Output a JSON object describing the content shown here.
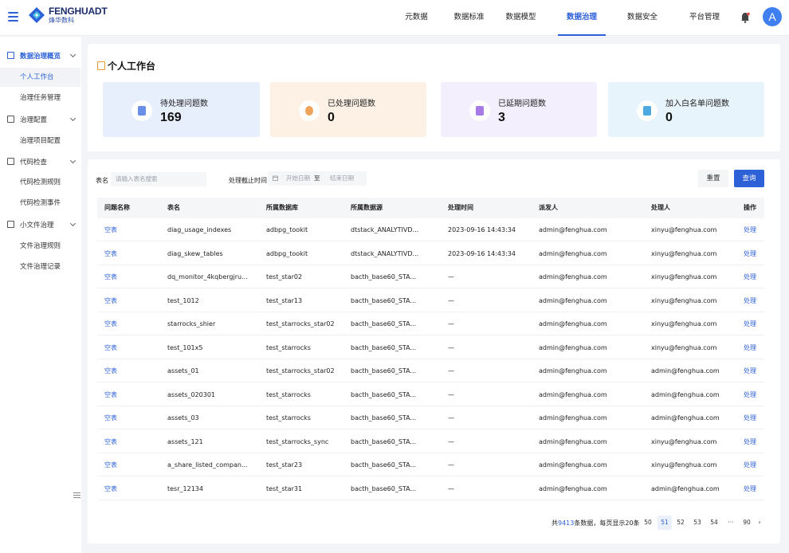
{
  "brand": {
    "name_en": "FENGHUADT",
    "name_cn": "烽华数科"
  },
  "nav": [
    "元数据",
    "数据标准",
    "数据模型",
    "数据治理",
    "数据安全",
    "平台管理"
  ],
  "nav_active": "数据治理",
  "user": {
    "avatar_letter": "A"
  },
  "sidebar": {
    "groups": [
      {
        "label": "数据治理概览",
        "items": [
          "个人工作台",
          "治理任务管理"
        ]
      },
      {
        "label": "治理配置",
        "items": [
          "治理项目配置"
        ]
      },
      {
        "label": "代码检查",
        "items": [
          "代码检测规则",
          "代码检测事件"
        ]
      },
      {
        "label": "小文件治理",
        "items": [
          "文件治理规则",
          "文件治理记录"
        ]
      }
    ],
    "active_item": "个人工作台"
  },
  "workbench": {
    "title": "个人工作台",
    "stats": [
      {
        "label": "待处理问题数",
        "value": "169",
        "bg": "#e7effd",
        "accent": "#6a8fe8"
      },
      {
        "label": "已处理问题数",
        "value": "0",
        "bg": "#fdf1e6",
        "accent": "#f0a35a"
      },
      {
        "label": "已延期问题数",
        "value": "3",
        "bg": "#f4effd",
        "accent": "#a77be6"
      },
      {
        "label": "加入白名单问题数",
        "value": "0",
        "bg": "#e8f4fb",
        "accent": "#4da9e0"
      }
    ]
  },
  "filter": {
    "table_label": "表名",
    "table_placeholder": "请输入表名搜索",
    "deadline_label": "处理截止时间",
    "start_placeholder": "开始日期",
    "to": "至",
    "end_placeholder": "结束日期",
    "reset_label": "重置",
    "query_label": "查询"
  },
  "table": {
    "columns": [
      "问题名称",
      "表名",
      "所属数据库",
      "所属数据源",
      "处理时间",
      "派发人",
      "处理人",
      "操作"
    ],
    "rows": [
      [
        "空表",
        "diag_usage_indexes",
        "adbpg_tookit",
        "dtstack_ANALYTIVD...",
        "2023-09-16 14:43:34",
        "admin@fenghua.com",
        "xinyu@fenghua.com",
        "处理"
      ],
      [
        "空表",
        "diag_skew_tables",
        "adbpg_tookit",
        "dtstack_ANALYTIVD...",
        "2023-09-16 14:43:34",
        "admin@fenghua.com",
        "xinyu@fenghua.com",
        "处理"
      ],
      [
        "空表",
        "dq_monitor_4kqbergjru...",
        "test_star02",
        "bacth_base60_STA...",
        "—",
        "admin@fenghua.com",
        "xinyu@fenghua.com",
        "处理"
      ],
      [
        "空表",
        "test_1012",
        "test_star13",
        "bacth_base60_STA...",
        "—",
        "admin@fenghua.com",
        "xinyu@fenghua.com",
        "处理"
      ],
      [
        "空表",
        "starrocks_shier",
        "test_starrocks_star02",
        "bacth_base60_STA...",
        "—",
        "admin@fenghua.com",
        "xinyu@fenghua.com",
        "处理"
      ],
      [
        "空表",
        "test_101x5",
        "test_starrocks",
        "bacth_base60_STA...",
        "—",
        "admin@fenghua.com",
        "xinyu@fenghua.com",
        "处理"
      ],
      [
        "空表",
        "assets_01",
        "test_starrocks_star02",
        "bacth_base60_STA...",
        "—",
        "admin@fenghua.com",
        "admin@fenghua.com",
        "处理"
      ],
      [
        "空表",
        "assets_020301",
        "test_starrocks",
        "bacth_base60_STA...",
        "—",
        "admin@fenghua.com",
        "admin@fenghua.com",
        "处理"
      ],
      [
        "空表",
        "assets_03",
        "test_starrocks",
        "bacth_base60_STA...",
        "—",
        "admin@fenghua.com",
        "admin@fenghua.com",
        "处理"
      ],
      [
        "空表",
        "assets_121",
        "test_starrocks_sync",
        "bacth_base60_STA...",
        "—",
        "admin@fenghua.com",
        "xinyu@fenghua.com",
        "处理"
      ],
      [
        "空表",
        "a_share_listed_compan...",
        "test_star23",
        "bacth_base60_STA...",
        "—",
        "admin@fenghua.com",
        "xinyu@fenghua.com",
        "处理"
      ],
      [
        "空表",
        "tesr_12134",
        "test_star31",
        "bacth_base60_STA...",
        "—",
        "admin@fenghua.com",
        "admin@fenghua.com",
        "处理"
      ]
    ]
  },
  "pagination": {
    "prefix": "共",
    "total": "9413",
    "suffix": "条数据，每页显示20条",
    "pages": [
      "50",
      "51",
      "52",
      "53",
      "54",
      "···",
      "90"
    ],
    "current": "51",
    "prev": "‹",
    "next": "›"
  }
}
